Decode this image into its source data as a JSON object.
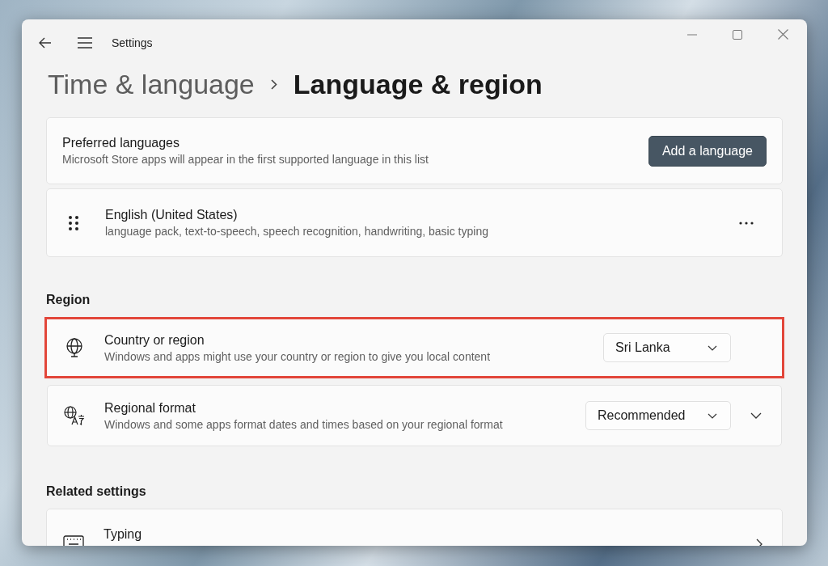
{
  "window": {
    "title": "Settings"
  },
  "breadcrumb": [
    {
      "label": "Time & language",
      "current": false
    },
    {
      "label": "Language & region",
      "current": true
    }
  ],
  "preferred_languages": {
    "title": "Preferred languages",
    "description": "Microsoft Store apps will appear in the first supported language in this list",
    "button": "Add a language"
  },
  "languages": [
    {
      "name": "English (United States)",
      "features": "language pack, text-to-speech, speech recognition, handwriting, basic typing"
    }
  ],
  "region": {
    "heading": "Region",
    "settings": [
      {
        "kind": "dropdown",
        "title": "Country or region",
        "description": "Windows and apps might use your country or region to give you local content",
        "value": "Sri Lanka",
        "highlighted": true,
        "expandable": false
      },
      {
        "kind": "dropdown",
        "title": "Regional format",
        "description": "Windows and some apps format dates and times based on your regional format",
        "value": "Recommended",
        "highlighted": false,
        "expandable": true
      }
    ]
  },
  "related_settings": {
    "heading": "Related settings",
    "items": [
      {
        "title": "Typing"
      }
    ]
  }
}
